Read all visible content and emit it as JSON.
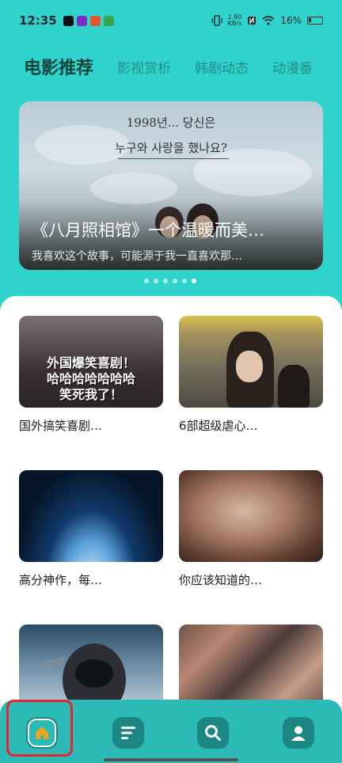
{
  "status_bar": {
    "time": "12:35",
    "net_speed_value": "2.80",
    "net_speed_unit": "KB/s",
    "battery": "16%"
  },
  "tabs": [
    {
      "label": "电影推荐",
      "active": true
    },
    {
      "label": "影视赏析",
      "active": false
    },
    {
      "label": "韩剧动态",
      "active": false
    },
    {
      "label": "动漫番",
      "active": false
    }
  ],
  "banner": {
    "korean_line1": "1998년... 당신은",
    "korean_line2": "누구와 사랑을 했나요?",
    "title": "《八月照相馆》一个温暖而美…",
    "subtitle": "我喜欢这个故事，可能源于我一直喜欢那…",
    "dots_total": 6,
    "active_dot": 6
  },
  "cards": [
    {
      "title": "国外搞笑喜剧…",
      "thumb_text_1": "外国爆笑喜剧！",
      "thumb_text_2": "哈哈哈哈哈哈哈",
      "thumb_text_3": "笑死我了！"
    },
    {
      "title": "6部超级虐心…"
    },
    {
      "title": "高分神作，每…"
    },
    {
      "title": "你应该知道的…"
    },
    {
      "title": ""
    },
    {
      "title": ""
    }
  ],
  "bottom_nav": [
    {
      "icon": "home-icon",
      "active": true
    },
    {
      "icon": "list-icon",
      "active": false
    },
    {
      "icon": "search-icon",
      "active": false
    },
    {
      "icon": "profile-icon",
      "active": false
    }
  ],
  "colors": {
    "background": "#2fd3cc",
    "nav_bar": "#2bbab5",
    "nav_icon_bg": "#1b8682",
    "home_icon": "#f0a21a",
    "highlight": "#e0262e"
  }
}
